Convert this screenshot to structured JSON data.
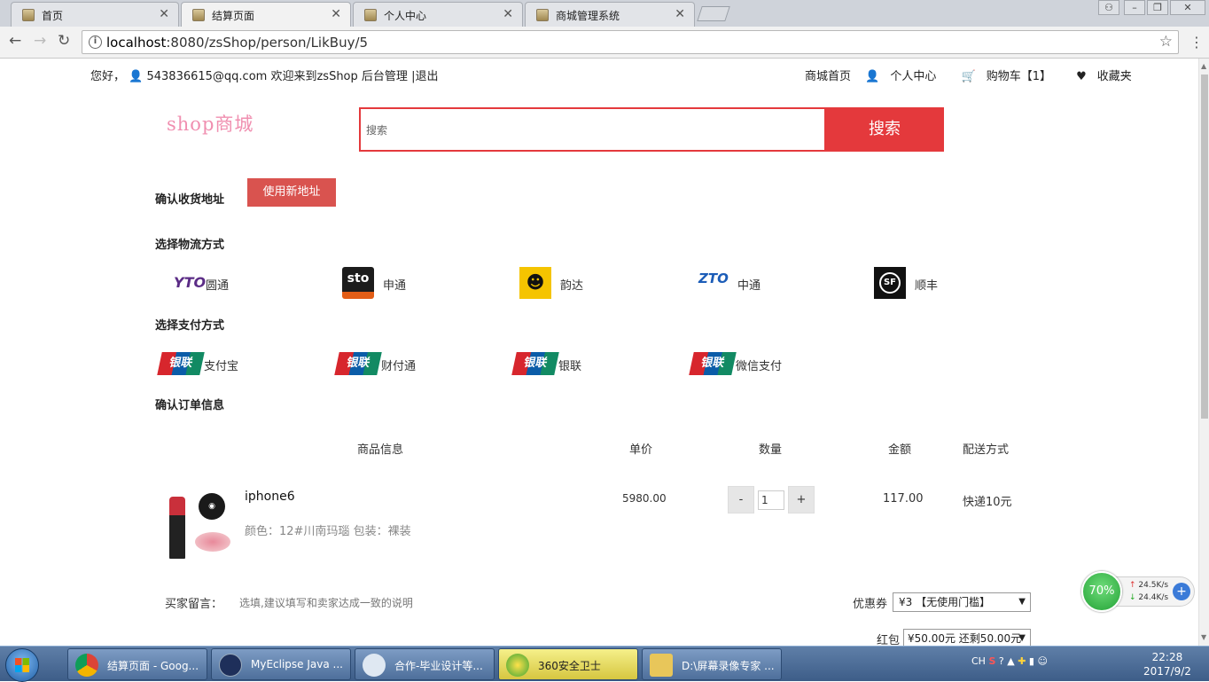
{
  "browser": {
    "tabs": [
      {
        "title": "首页",
        "active": false
      },
      {
        "title": "结算页面",
        "active": true
      },
      {
        "title": "个人中心",
        "active": false
      },
      {
        "title": "商城管理系统",
        "active": false
      }
    ],
    "url_host": "localhost",
    "url_path": ":8080/zsShop/person/LikBuy/5"
  },
  "topbar": {
    "greeting": "您好，",
    "user": "543836615@qq.com",
    "welcome": "欢迎来到zsShop",
    "admin": "后台管理",
    "logout": "|退出",
    "links": [
      "商城首页",
      "个人中心",
      "购物车【1】",
      "收藏夹"
    ]
  },
  "header": {
    "logo": "shop商城",
    "search_placeholder": "搜索",
    "search_button": "搜索"
  },
  "address": {
    "title": "确认收货地址",
    "new_button": "使用新地址"
  },
  "logistics": {
    "title": "选择物流方式",
    "options": [
      {
        "name": "圆通",
        "icon": "yto-logo"
      },
      {
        "name": "申通",
        "icon": "sto-logo"
      },
      {
        "name": "韵达",
        "icon": "yunda-logo"
      },
      {
        "name": "中通",
        "icon": "zto-logo"
      },
      {
        "name": "顺丰",
        "icon": "sf-logo"
      }
    ]
  },
  "payment": {
    "title": "选择支付方式",
    "options": [
      "支付宝",
      "财付通",
      "银联",
      "微信支付"
    ],
    "icon_text": "银联"
  },
  "order": {
    "title": "确认订单信息",
    "columns": [
      "商品信息",
      "单价",
      "数量",
      "金额",
      "配送方式"
    ],
    "item": {
      "name": "iphone6",
      "attrs": "颜色：12#川南玛瑙 包装：裸装",
      "price": "5980.00",
      "qty": "1",
      "amount": "117.00",
      "shipping": "快递10元",
      "minus": "-",
      "plus": "+"
    }
  },
  "footer": {
    "message_label": "买家留言：",
    "message_placeholder": "选填,建议填写和卖家达成一致的说明",
    "coupon_label": "优惠券",
    "coupon_value": "¥3 【无使用门槛】",
    "redpacket_label": "红包",
    "redpacket_value": "¥50.00元 还剩50.00元"
  },
  "widget": {
    "percent": "70%",
    "up": "24.5K/s",
    "down": "24.4K/s"
  },
  "taskbar": {
    "items": [
      {
        "title": "结算页面 - Goog...",
        "active": false
      },
      {
        "title": "MyEclipse Java ...",
        "active": false
      },
      {
        "title": "合作-毕业设计等...",
        "active": false
      },
      {
        "title": "360安全卫士",
        "active": true
      },
      {
        "title": "D:\\屏幕录像专家 ...",
        "active": false
      }
    ],
    "ime": "CH",
    "time": "22:28",
    "date": "2017/9/2"
  }
}
